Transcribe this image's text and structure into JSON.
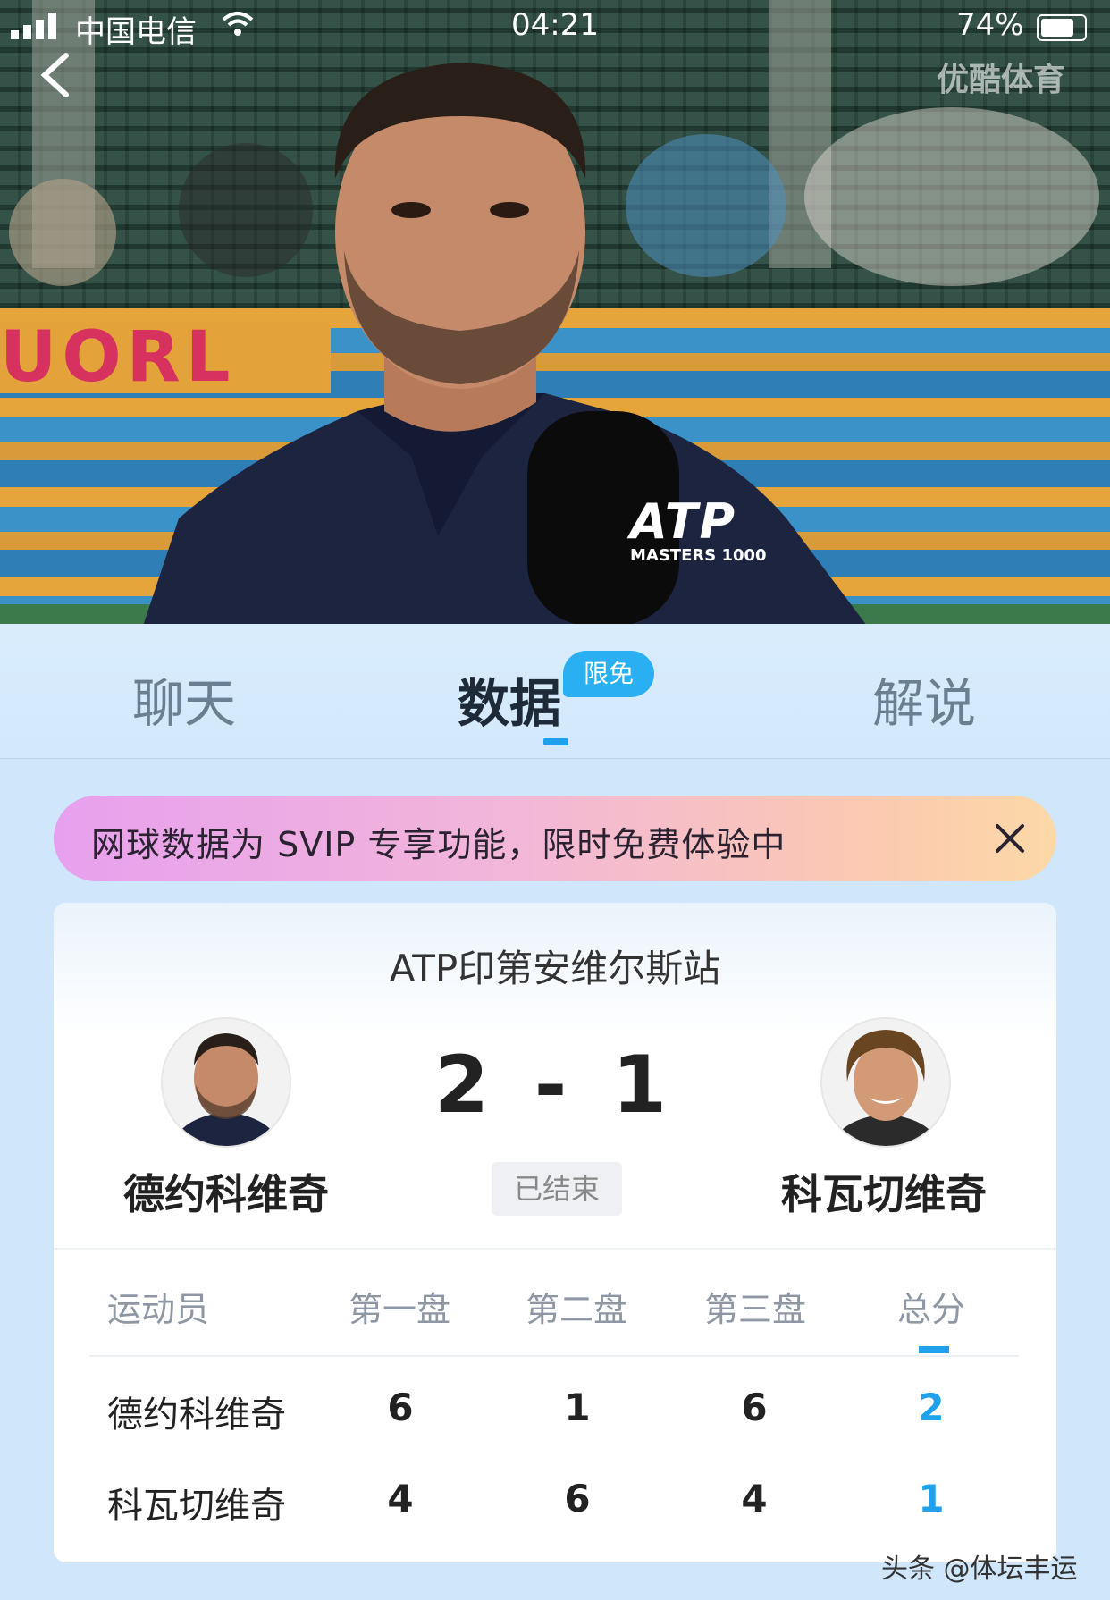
{
  "status_bar": {
    "carrier": "中国电信",
    "time": "04:21",
    "battery": "74%"
  },
  "video": {
    "watermark": "优酷体育",
    "mic_brand": "ATP",
    "mic_sub": "MASTERS 1000",
    "court_banner": "UORL"
  },
  "tabs": [
    {
      "label": "聊天"
    },
    {
      "label": "数据"
    },
    {
      "label": "解说"
    }
  ],
  "tab_badge": "限免",
  "promo": {
    "text": "网球数据为 SVIP 专享功能，限时免费体验中"
  },
  "match": {
    "tournament": "ATP印第安维尔斯站",
    "player_left": "德约科维奇",
    "player_right": "科瓦切维奇",
    "score": "2 - 1",
    "status": "已结束",
    "table": {
      "headers": [
        "运动员",
        "第一盘",
        "第二盘",
        "第三盘",
        "总分"
      ],
      "rows": [
        {
          "name": "德约科维奇",
          "s1": "6",
          "s2": "1",
          "s3": "6",
          "total": "2"
        },
        {
          "name": "科瓦切维奇",
          "s1": "4",
          "s2": "6",
          "s3": "4",
          "total": "1"
        }
      ]
    }
  },
  "credit": "头条 @体坛丰运",
  "colors": {
    "accent": "#1fa1ec",
    "badge": "#2ab0f2",
    "page_bg": "#cfe6fb"
  }
}
